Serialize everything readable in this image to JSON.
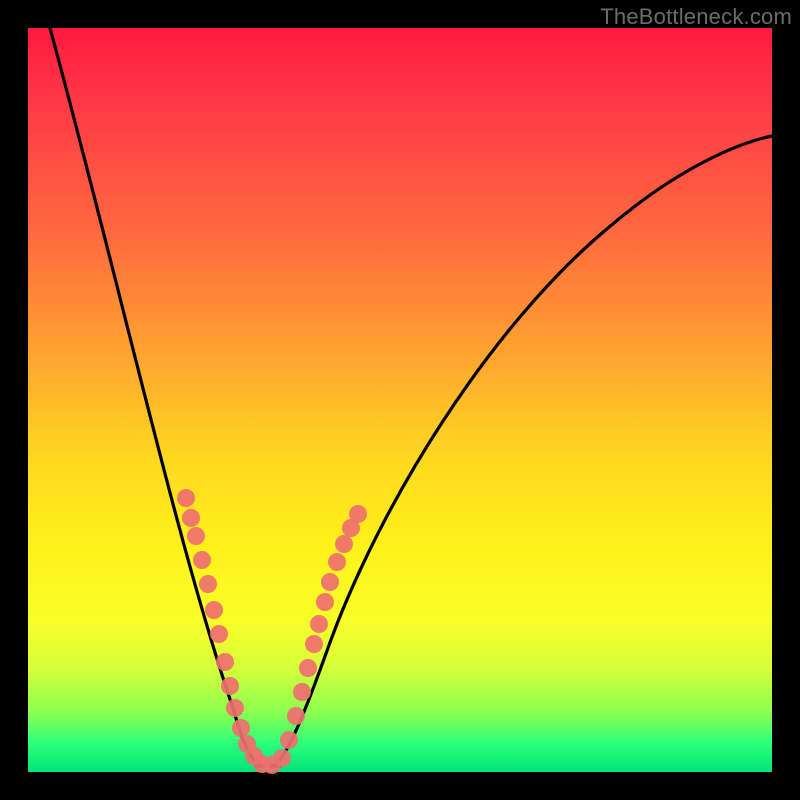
{
  "watermark": {
    "text": "TheBottleneck.com"
  },
  "chart_data": {
    "type": "line",
    "title": "",
    "xlabel": "",
    "ylabel": "",
    "xlim": [
      0,
      100
    ],
    "ylim": [
      0,
      100
    ],
    "grid": false,
    "legend": false,
    "series": [
      {
        "name": "bottleneck-curve",
        "x": [
          3,
          8,
          15,
          20,
          24,
          27,
          30,
          34,
          40,
          50,
          60,
          72,
          85,
          100
        ],
        "y": [
          100,
          80,
          55,
          38,
          22,
          10,
          2,
          4,
          20,
          45,
          60,
          72,
          80,
          85
        ],
        "color": "#000000"
      }
    ],
    "markers": [
      {
        "name": "left-branch-dots",
        "x": [
          19.5,
          20.3,
          21.2,
          22.3,
          23.3,
          24.4,
          25.0,
          26.0,
          26.7,
          27.5,
          28.3,
          29.0,
          29.8,
          30.8,
          32.0,
          33.0
        ],
        "y": [
          37,
          35,
          32,
          28,
          25,
          21,
          18,
          14,
          11,
          8,
          6,
          4,
          3,
          2,
          2,
          2
        ],
        "color": "#f07070"
      },
      {
        "name": "right-branch-dots",
        "x": [
          33.8,
          34.6,
          35.5,
          36.2,
          37.0,
          37.8,
          38.4,
          39.2,
          39.7,
          40.6,
          41.4,
          42.2,
          43.0
        ],
        "y": [
          4,
          7,
          12,
          16,
          20,
          24,
          27,
          30,
          33,
          35,
          37,
          38,
          39
        ],
        "color": "#f07070"
      }
    ]
  }
}
